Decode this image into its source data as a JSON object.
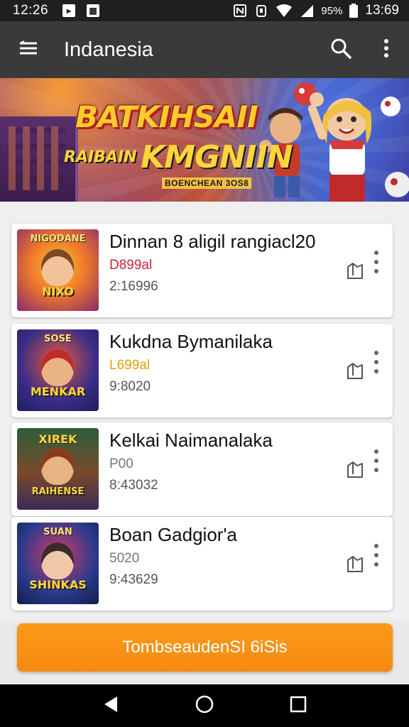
{
  "status_bar": {
    "time": "12:26",
    "battery_pct": "95%",
    "clock_right": "13:69",
    "icons": [
      "notification-icon",
      "notification-icon",
      "nfc-icon",
      "alarm-icon",
      "wifi-icon",
      "signal-icon",
      "battery-icon"
    ]
  },
  "app_bar": {
    "title": "Indanesia",
    "icons": [
      "menu-icon",
      "search-icon",
      "more-vert-icon"
    ]
  },
  "banner": {
    "headline_1": "BATKIHSAII",
    "headline_2_small": "RAIBAIN",
    "headline_2_big": "KMGNIIN",
    "subtitle": "BOENCHEAN 3OS8"
  },
  "items": [
    {
      "title": "Dinnan 8 aligil rangiacl20",
      "line1": "D899al",
      "line1_color": "#d0213a",
      "line2": "2:16996",
      "thumb_top": "NIGODANE",
      "thumb_caption": "NIXO",
      "thumb_colors": [
        "#f7a12b",
        "#e0522a",
        "#6b2a80"
      ]
    },
    {
      "title": "Kukdna Bymanilaka",
      "line1": "L699al",
      "line1_color": "#e3a10a",
      "line2": "9:8020",
      "thumb_top": "SOSE",
      "thumb_caption": "MENKAR",
      "thumb_colors": [
        "#3a2d88",
        "#c73a3a",
        "#2a7ad0"
      ]
    },
    {
      "title": "Kelkai Naimanalaka",
      "line1": "P00",
      "line1_color": "#777777",
      "line2": "8:43032",
      "thumb_top": "XIREK",
      "thumb_caption": "RAIHENSE",
      "thumb_colors": [
        "#2b5e3a",
        "#d0652a",
        "#3a3a88"
      ]
    },
    {
      "title": "Boan Gadgior'a",
      "line1": "5020",
      "line1_color": "#777777",
      "line2": "9:43629",
      "thumb_top": "SUAN",
      "thumb_caption": "SHINKAS",
      "thumb_colors": [
        "#2a3a8c",
        "#d23a6a",
        "#1e2a5e"
      ]
    }
  ],
  "cta": {
    "label": "TombseaudenSI 6iSis"
  },
  "nav_bar": {
    "icons": [
      "back-icon",
      "home-icon",
      "recents-icon"
    ]
  }
}
